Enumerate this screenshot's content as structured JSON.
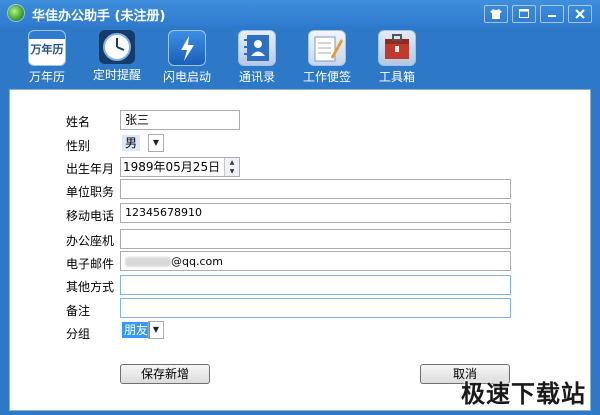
{
  "window": {
    "title": "华佳办公助手 (未注册)",
    "buttons": [
      "shirt-icon",
      "restore-icon",
      "minimize-icon",
      "close-icon"
    ]
  },
  "toolbar": {
    "items": [
      {
        "label": "万年历",
        "icon": "calendar-icon",
        "icon_text": "万年历"
      },
      {
        "label": "定时提醒",
        "icon": "clock-icon"
      },
      {
        "label": "闪电启动",
        "icon": "lightning-icon"
      },
      {
        "label": "通讯录",
        "icon": "contacts-icon"
      },
      {
        "label": "工作便签",
        "icon": "notes-icon"
      },
      {
        "label": "工具箱",
        "icon": "toolbox-icon"
      }
    ]
  },
  "form": {
    "name": {
      "label": "姓名",
      "value": "张三"
    },
    "gender": {
      "label": "性别",
      "value": "男"
    },
    "birthday": {
      "label": "出生年月",
      "value": "1989年05月25日"
    },
    "position": {
      "label": "单位职务",
      "value": ""
    },
    "mobile": {
      "label": "移动电话",
      "value": "12345678910"
    },
    "office_phone": {
      "label": "办公座机",
      "value": ""
    },
    "email": {
      "label": "电子邮件",
      "value_suffix": "@qq.com"
    },
    "other": {
      "label": "其他方式",
      "value": ""
    },
    "note": {
      "label": "备注",
      "value": ""
    },
    "group": {
      "label": "分组",
      "value": "朋友"
    }
  },
  "actions": {
    "save_label": "保存新增",
    "cancel_label": "取消"
  },
  "watermark": "极速下载站",
  "colors": {
    "titlebar": "#2f7bd0",
    "window_bg": "#2d79c7",
    "content_bg": "#ffffff",
    "group_highlight": "#3399ff"
  }
}
